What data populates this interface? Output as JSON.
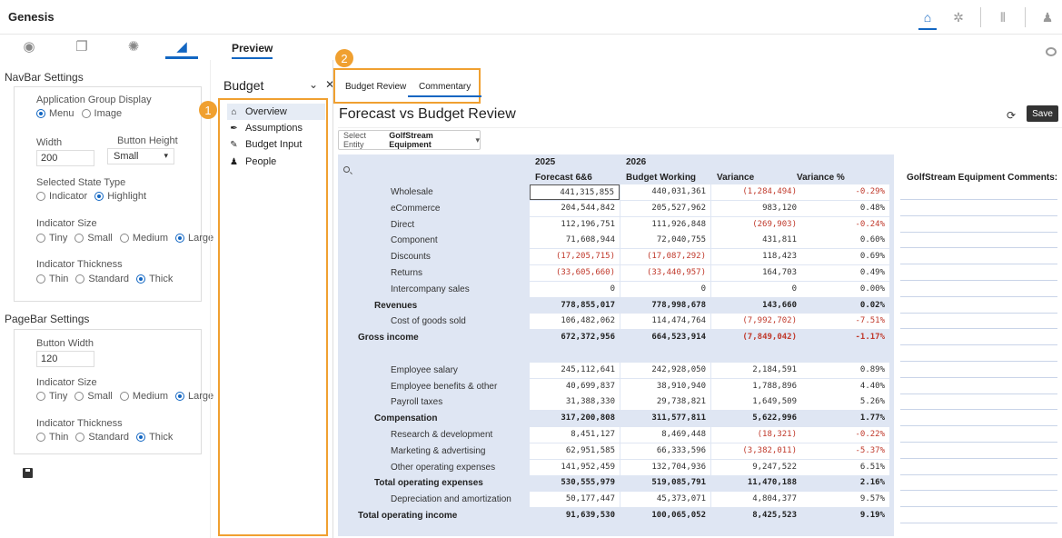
{
  "app": {
    "title": "Genesis"
  },
  "top_icons": [
    "home-icon",
    "gear-icon",
    "library-icon",
    "user-icon"
  ],
  "preview_tab": "Preview",
  "navbar_settings": {
    "title": "NavBar Settings",
    "app_group_display": {
      "label": "Application Group Display",
      "options": [
        "Menu",
        "Image"
      ],
      "selected": "Menu"
    },
    "width": {
      "label": "Width",
      "value": "200"
    },
    "button_height": {
      "label": "Button Height",
      "value": "Small"
    },
    "selected_state": {
      "label": "Selected State Type",
      "options": [
        "Indicator",
        "Highlight"
      ],
      "selected": "Highlight"
    },
    "indicator_size": {
      "label": "Indicator Size",
      "options": [
        "Tiny",
        "Small",
        "Medium",
        "Large"
      ],
      "selected": "Large"
    },
    "indicator_thickness": {
      "label": "Indicator Thickness",
      "options": [
        "Thin",
        "Standard",
        "Thick"
      ],
      "selected": "Thick"
    }
  },
  "pagebar_settings": {
    "title": "PageBar Settings",
    "button_width": {
      "label": "Button Width",
      "value": "120"
    },
    "indicator_size": {
      "label": "Indicator Size",
      "options": [
        "Tiny",
        "Small",
        "Medium",
        "Large"
      ],
      "selected": "Large"
    },
    "indicator_thickness": {
      "label": "Indicator Thickness",
      "options": [
        "Thin",
        "Standard",
        "Thick"
      ],
      "selected": "Thick"
    }
  },
  "budget_panel": {
    "title": "Budget",
    "badge": "1",
    "items": [
      {
        "label": "Overview",
        "icon": "home-icon"
      },
      {
        "label": "Assumptions",
        "icon": "pen-icon"
      },
      {
        "label": "Budget Input",
        "icon": "edit-icon"
      },
      {
        "label": "People",
        "icon": "people-icon"
      }
    ],
    "selected": "Overview"
  },
  "tabs": {
    "badge": "2",
    "items": [
      "Budget Review",
      "Commentary"
    ],
    "active": "Commentary"
  },
  "report": {
    "title": "Forecast vs Budget Review",
    "save_label": "Save",
    "entity_prefix": "Select Entity",
    "entity_value": "GolfStream Equipment",
    "columns": [
      {
        "year": "2025",
        "name": "Forecast 6&6"
      },
      {
        "year": "2026",
        "name": "Budget Working"
      },
      {
        "year": "",
        "name": "Variance"
      },
      {
        "year": "",
        "name": "Variance %"
      }
    ],
    "comments_header": "GolfStream Equipment Comments:",
    "rows": [
      {
        "label": "Wholesale",
        "indent": 2,
        "bold": false,
        "v": [
          "441,315,855",
          "440,031,361",
          "(1,284,494)",
          "-0.29%"
        ]
      },
      {
        "label": "eCommerce",
        "indent": 2,
        "bold": false,
        "v": [
          "204,544,842",
          "205,527,962",
          "983,120",
          "0.48%"
        ]
      },
      {
        "label": "Direct",
        "indent": 2,
        "bold": false,
        "v": [
          "112,196,751",
          "111,926,848",
          "(269,903)",
          "-0.24%"
        ]
      },
      {
        "label": "Component",
        "indent": 2,
        "bold": false,
        "v": [
          "71,608,944",
          "72,040,755",
          "431,811",
          "0.60%"
        ]
      },
      {
        "label": "Discounts",
        "indent": 2,
        "bold": false,
        "v": [
          "(17,205,715)",
          "(17,087,292)",
          "118,423",
          "0.69%"
        ]
      },
      {
        "label": "Returns",
        "indent": 2,
        "bold": false,
        "v": [
          "(33,605,660)",
          "(33,440,957)",
          "164,703",
          "0.49%"
        ]
      },
      {
        "label": "Intercompany sales",
        "indent": 2,
        "bold": false,
        "v": [
          "0",
          "0",
          "0",
          "0.00%"
        ]
      },
      {
        "label": "Revenues",
        "indent": 1,
        "bold": true,
        "v": [
          "778,855,017",
          "778,998,678",
          "143,660",
          "0.02%"
        ]
      },
      {
        "label": "Cost of goods sold",
        "indent": 2,
        "bold": false,
        "v": [
          "106,482,062",
          "114,474,764",
          "(7,992,702)",
          "-7.51%"
        ]
      },
      {
        "label": "Gross income",
        "indent": 0,
        "bold": true,
        "v": [
          "672,372,956",
          "664,523,914",
          "(7,849,042)",
          "-1.17%"
        ]
      },
      {
        "label": "",
        "indent": 0,
        "bold": false,
        "v": [
          "",
          "",
          "",
          ""
        ]
      },
      {
        "label": "Employee salary",
        "indent": 2,
        "bold": false,
        "v": [
          "245,112,641",
          "242,928,050",
          "2,184,591",
          "0.89%"
        ]
      },
      {
        "label": "Employee benefits & other",
        "indent": 2,
        "bold": false,
        "v": [
          "40,699,837",
          "38,910,940",
          "1,788,896",
          "4.40%"
        ]
      },
      {
        "label": "Payroll taxes",
        "indent": 2,
        "bold": false,
        "v": [
          "31,388,330",
          "29,738,821",
          "1,649,509",
          "5.26%"
        ]
      },
      {
        "label": "Compensation",
        "indent": 1,
        "bold": true,
        "v": [
          "317,200,808",
          "311,577,811",
          "5,622,996",
          "1.77%"
        ]
      },
      {
        "label": "Research & development",
        "indent": 2,
        "bold": false,
        "v": [
          "8,451,127",
          "8,469,448",
          "(18,321)",
          "-0.22%"
        ]
      },
      {
        "label": "Marketing & advertising",
        "indent": 2,
        "bold": false,
        "v": [
          "62,951,585",
          "66,333,596",
          "(3,382,011)",
          "-5.37%"
        ]
      },
      {
        "label": "Other operating expenses",
        "indent": 2,
        "bold": false,
        "v": [
          "141,952,459",
          "132,704,936",
          "9,247,522",
          "6.51%"
        ]
      },
      {
        "label": "Total operating expenses",
        "indent": 1,
        "bold": true,
        "v": [
          "530,555,979",
          "519,085,791",
          "11,470,188",
          "2.16%"
        ]
      },
      {
        "label": "Depreciation and amortization",
        "indent": 2,
        "bold": false,
        "v": [
          "50,177,447",
          "45,373,071",
          "4,804,377",
          "9.57%"
        ]
      },
      {
        "label": "Total operating income",
        "indent": 0,
        "bold": true,
        "v": [
          "91,639,530",
          "100,065,052",
          "8,425,523",
          "9.19%"
        ]
      }
    ]
  }
}
